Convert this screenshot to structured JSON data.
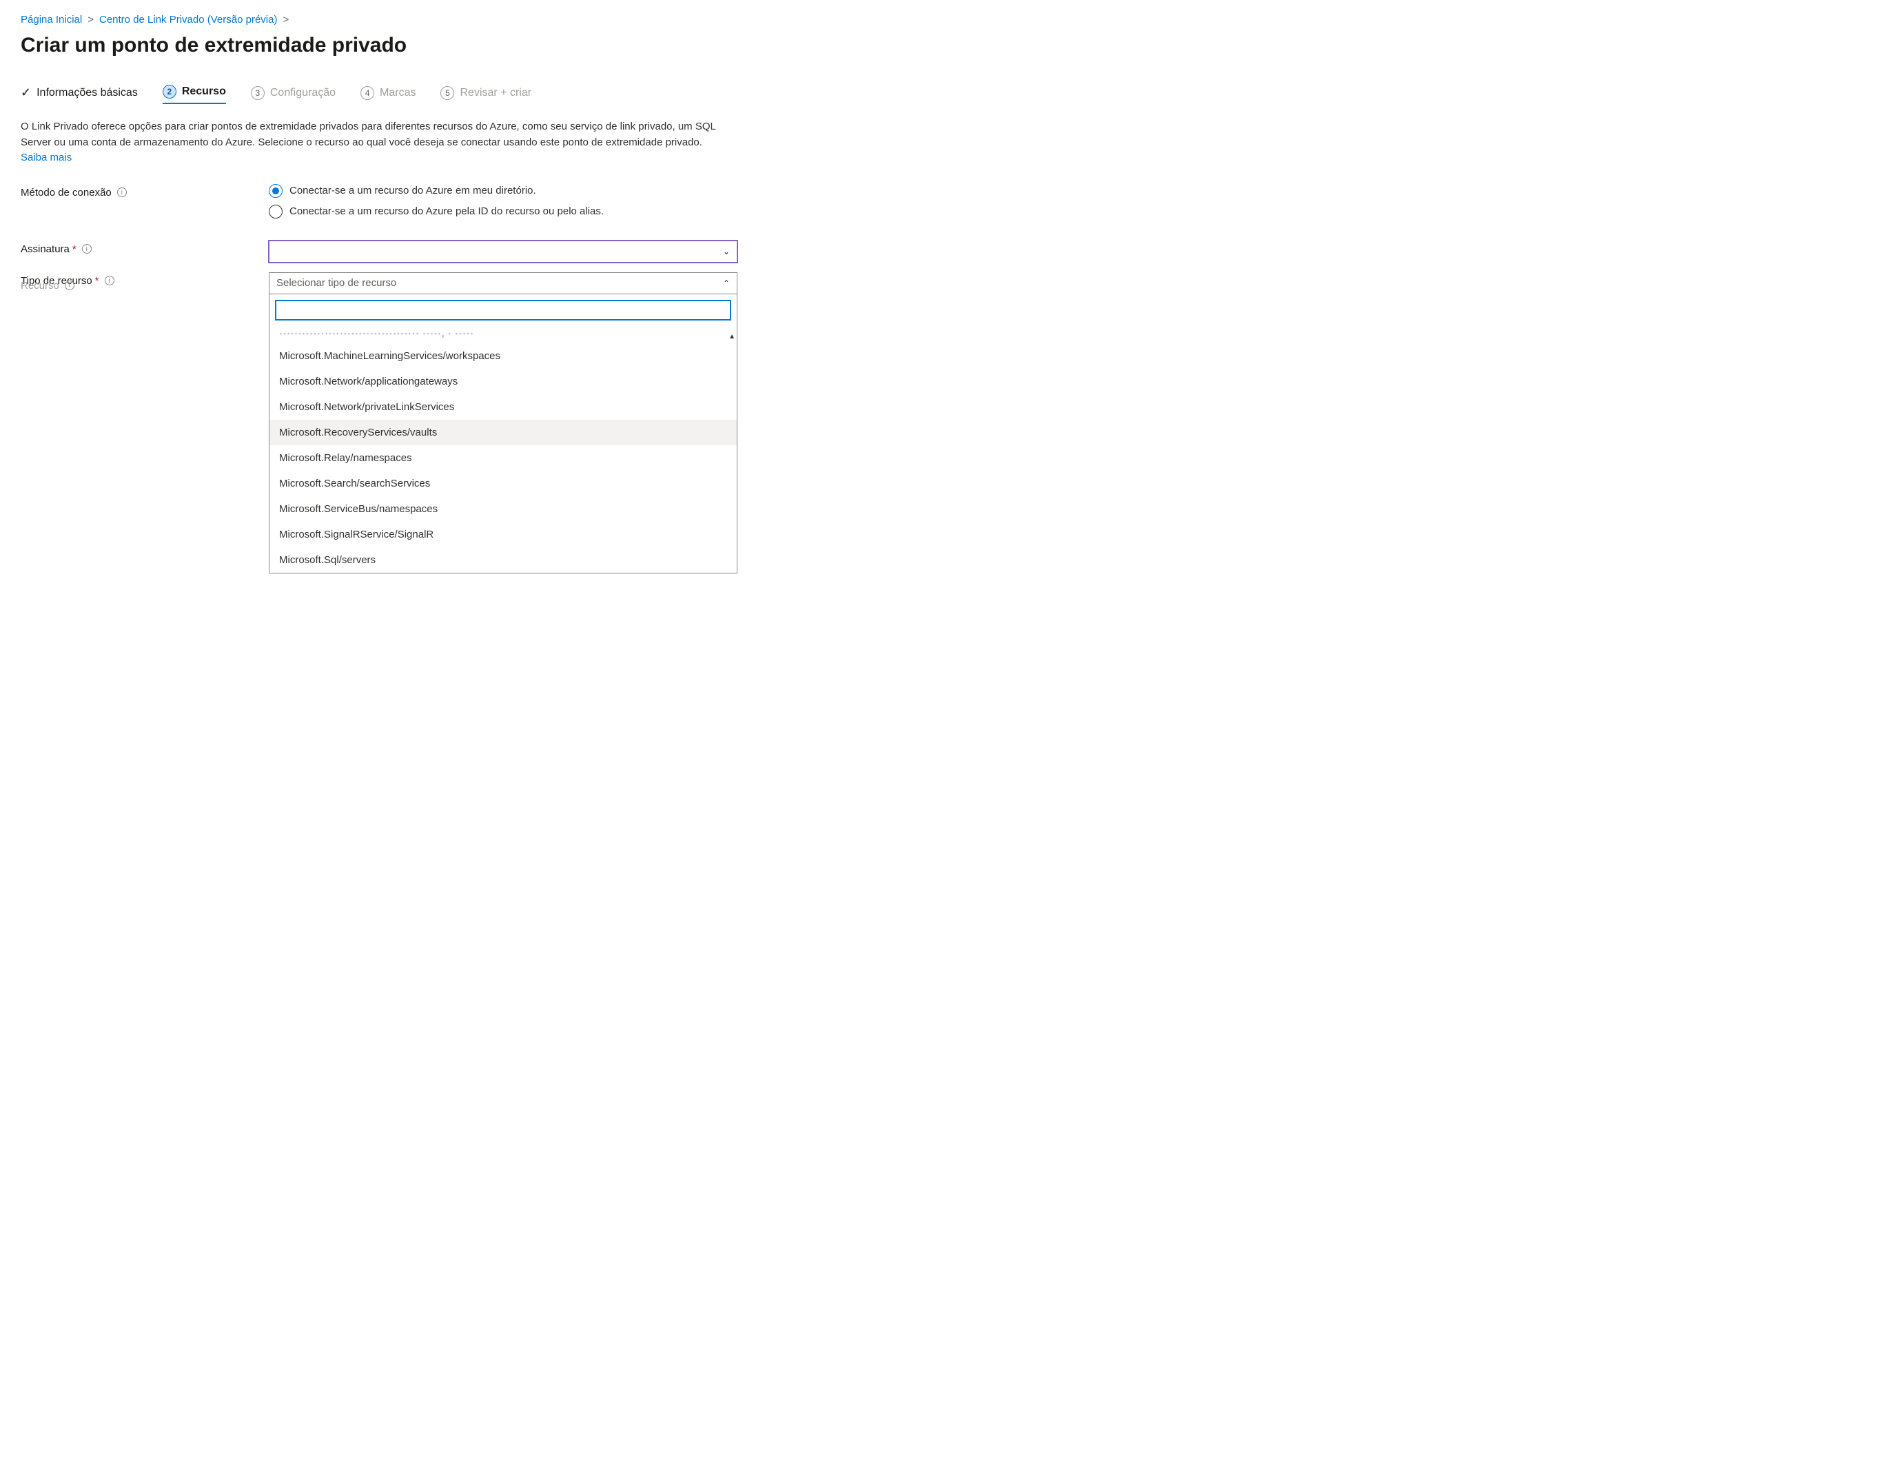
{
  "breadcrumb": {
    "items": [
      {
        "label": "Página Inicial"
      },
      {
        "label": "Centro de Link Privado (Versão prévia)"
      }
    ]
  },
  "page": {
    "title": "Criar um ponto de extremidade privado"
  },
  "tabs": {
    "t0": {
      "label": "Informações básicas"
    },
    "t1": {
      "num": "2",
      "label": "Recurso"
    },
    "t2": {
      "num": "3",
      "label": "Configuração"
    },
    "t3": {
      "num": "4",
      "label": "Marcas"
    },
    "t4": {
      "num": "5",
      "label": "Revisar + criar"
    }
  },
  "intro": {
    "text": "O Link Privado oferece opções para criar pontos de extremidade privados para diferentes recursos do Azure, como seu serviço de link privado, um SQL Server ou uma conta de armazenamento do Azure. Selecione o recurso ao qual você deseja se conectar usando este ponto de extremidade privado. ",
    "learn_more": "Saiba mais"
  },
  "form": {
    "connection_method": {
      "label": "Método de conexão",
      "options": [
        "Conectar-se a um recurso do Azure em meu diretório.",
        "Conectar-se a um recurso do Azure pela ID do recurso ou pelo alias."
      ],
      "selected_index": 0
    },
    "subscription": {
      "label": "Assinatura",
      "value": ""
    },
    "resource_type": {
      "label": "Tipo de recurso",
      "placeholder": "Selecionar tipo de recurso",
      "options": [
        "Microsoft.MachineLearningServices/workspaces",
        "Microsoft.Network/applicationgateways",
        "Microsoft.Network/privateLinkServices",
        "Microsoft.RecoveryServices/vaults",
        "Microsoft.Relay/namespaces",
        "Microsoft.Search/searchServices",
        "Microsoft.ServiceBus/namespaces",
        "Microsoft.SignalRService/SignalR",
        "Microsoft.Sql/servers"
      ],
      "hovered_index": 3,
      "search_value": ""
    },
    "resource": {
      "label": "Recurso"
    }
  }
}
